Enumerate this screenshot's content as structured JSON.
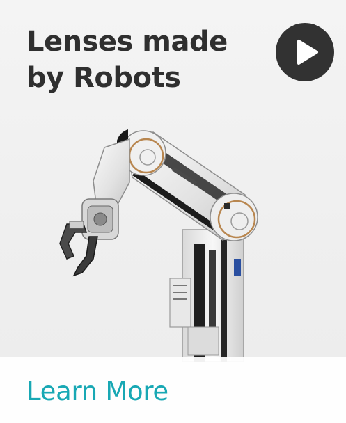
{
  "hero": {
    "headline_line1": "Lenses made",
    "headline_line2": "by Robots",
    "play_button_icon": "play-icon"
  },
  "illustration": {
    "subject": "robot-arm"
  },
  "cta": {
    "label": "Learn More",
    "color": "#18a8b4"
  },
  "colors": {
    "headline": "#2f2f2f",
    "play_button_bg": "#323232",
    "background": "#f2f2f2"
  }
}
